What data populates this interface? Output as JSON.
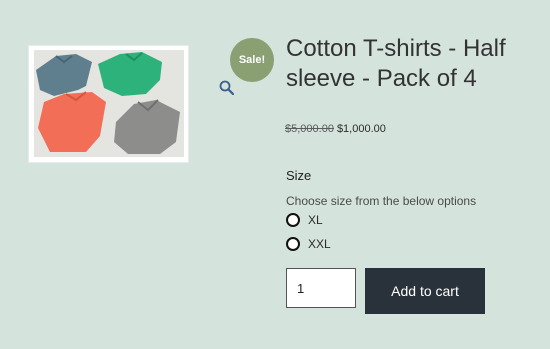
{
  "product": {
    "title": "Cotton T-shirts - Half sleeve - Pack of 4",
    "sale_badge": "Sale!",
    "price_old": "$5,000.00",
    "price_new": "$1,000.00"
  },
  "variation": {
    "label": "Size",
    "hint": "Choose size from the below options",
    "options": [
      {
        "label": "XL",
        "selected": false
      },
      {
        "label": "XXL",
        "selected": false
      }
    ]
  },
  "cart": {
    "quantity": "1",
    "button_label": "Add to cart"
  },
  "icons": {
    "zoom": "magnifier-icon"
  },
  "colors": {
    "background": "#d4e3dc",
    "sale_badge": "#8aa073",
    "button": "#29323a",
    "shirts": [
      "#5e7d8f",
      "#2fb37c",
      "#f06e58",
      "#8c8c8a"
    ]
  }
}
